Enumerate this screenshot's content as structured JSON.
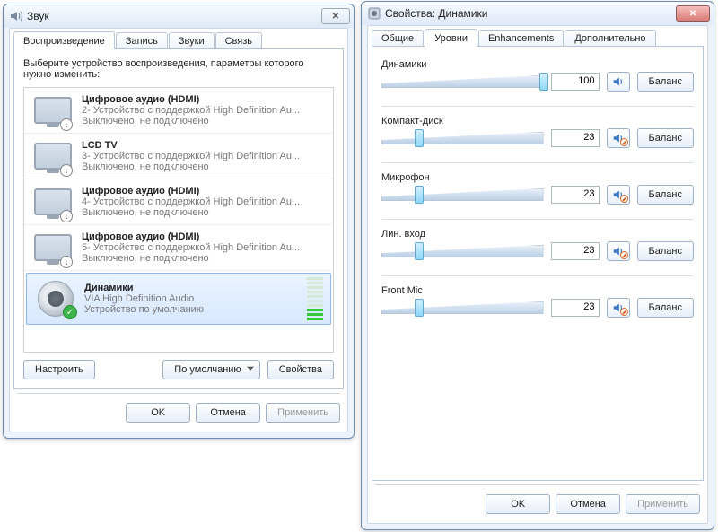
{
  "win1": {
    "title": "Звук",
    "tabs": [
      "Воспроизведение",
      "Запись",
      "Звуки",
      "Связь"
    ],
    "instruction": "Выберите устройство воспроизведения, параметры которого нужно изменить:",
    "devices": [
      {
        "name": "Цифровое аудио (HDMI)",
        "desc": "2- Устройство с поддержкой High Definition Au...",
        "status": "Выключено, не подключено",
        "type": "monitor",
        "badge": "↓"
      },
      {
        "name": "LCD TV",
        "desc": "3- Устройство с поддержкой High Definition Au...",
        "status": "Выключено, не подключено",
        "type": "monitor",
        "badge": "↓"
      },
      {
        "name": "Цифровое аудио (HDMI)",
        "desc": "4- Устройство с поддержкой High Definition Au...",
        "status": "Выключено, не подключено",
        "type": "monitor",
        "badge": "↓"
      },
      {
        "name": "Цифровое аудио (HDMI)",
        "desc": "5- Устройство с поддержкой High Definition Au...",
        "status": "Выключено, не подключено",
        "type": "monitor",
        "badge": "↓"
      },
      {
        "name": "Динамики",
        "desc": "VIA High Definition Audio",
        "status": "Устройство по умолчанию",
        "type": "speaker",
        "default": true,
        "selected": true
      }
    ],
    "buttons": {
      "configure": "Настроить",
      "set_default": "По умолчанию",
      "properties": "Свойства"
    },
    "footer": {
      "ok": "OK",
      "cancel": "Отмена",
      "apply": "Применить"
    }
  },
  "win2": {
    "title": "Свойства: Динамики",
    "tabs": [
      "Общие",
      "Уровни",
      "Enhancements",
      "Дополнительно"
    ],
    "balance": "Баланс",
    "levels": [
      {
        "name": "Динамики",
        "value": 100,
        "muted": false
      },
      {
        "name": "Компакт-диск",
        "value": 23,
        "muted": true
      },
      {
        "name": "Микрофон",
        "value": 23,
        "muted": true
      },
      {
        "name": "Лин. вход",
        "value": 23,
        "muted": true
      },
      {
        "name": "Front Mic",
        "value": 23,
        "muted": true
      }
    ],
    "footer": {
      "ok": "OK",
      "cancel": "Отмена",
      "apply": "Применить"
    }
  }
}
